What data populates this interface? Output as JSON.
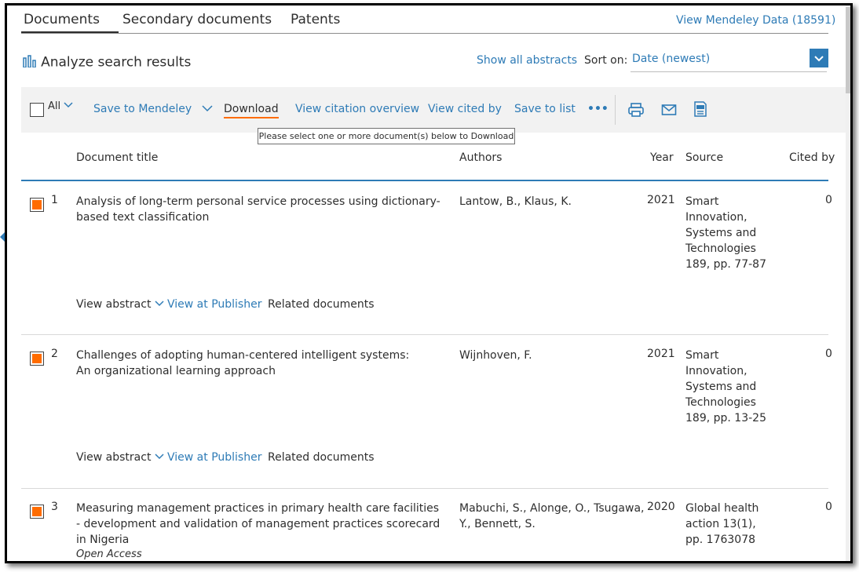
{
  "tabs": [
    "Documents",
    "Secondary documents",
    "Patents"
  ],
  "mendeley_data_link": "View Mendeley Data (18591)",
  "analyze": {
    "icon": "bar-chart-icon",
    "label": "Analyze search results"
  },
  "show_all_abstracts": "Show all abstracts",
  "sort": {
    "label": "Sort on:",
    "value": "Date (newest)"
  },
  "toolbar": {
    "all_label": "All",
    "save_to_mendeley": "Save to Mendeley",
    "download": "Download",
    "view_citation_overview": "View citation overview",
    "view_cited_by": "View cited by",
    "save_to_list": "Save to list",
    "more": "•••",
    "icons": [
      "print-icon",
      "email-icon",
      "pdf-icon"
    ]
  },
  "tooltip": "Please select one or more document(s) below to Download",
  "columns": {
    "title": "Document title",
    "authors": "Authors",
    "year": "Year",
    "source": "Source",
    "cited_by": "Cited by"
  },
  "results": [
    {
      "num": "1",
      "selected": true,
      "title": "Analysis of long-term personal service processes using dictionary-based text classification",
      "authors": "Lantow, B., Klaus, K.",
      "year": "2021",
      "source": "Smart Innovation, Systems and Technologies 189, pp. 77-87",
      "cited": "0",
      "actions": [
        "View abstract",
        "View at Publisher",
        "Related documents"
      ]
    },
    {
      "num": "2",
      "selected": true,
      "title": "Challenges of adopting human-centered intelligent systems: An organizational learning approach",
      "authors": "Wijnhoven, F.",
      "year": "2021",
      "source": "Smart Innovation, Systems and Technologies 189, pp. 13-25",
      "cited": "0",
      "actions": [
        "View abstract",
        "View at Publisher",
        "Related documents"
      ]
    },
    {
      "num": "3",
      "selected": true,
      "title": "Measuring management practices in primary health care facilities - development and validation of management practices scorecard in Nigeria",
      "access": "Open Access",
      "authors": "Mabuchi, S., Alonge, O., Tsugawa, Y., Bennett, S.",
      "year": "2020",
      "source": "Global health action 13(1), pp. 1763078",
      "cited": "0"
    }
  ]
}
